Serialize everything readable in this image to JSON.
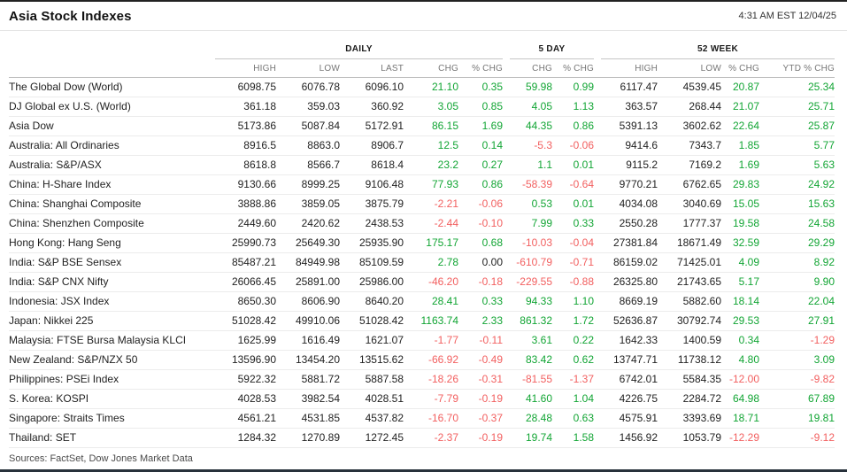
{
  "header": {
    "title": "Asia Stock Indexes",
    "timestamp": "4:31 AM EST 12/04/25"
  },
  "colors": {
    "positive": "#12a534",
    "negative": "#f25f5f",
    "neutral": "#222222"
  },
  "table": {
    "groups": [
      {
        "label": "DAILY"
      },
      {
        "label": "5 DAY"
      },
      {
        "label": "52 WEEK"
      }
    ],
    "column_headers": [
      "HIGH",
      "LOW",
      "LAST",
      "CHG",
      "% CHG",
      "CHG",
      "% CHG",
      "HIGH",
      "LOW",
      "% CHG",
      "YTD % CHG"
    ],
    "rows": [
      {
        "name": "The Global Dow (World)",
        "daily_high": "6098.75",
        "daily_low": "6076.78",
        "daily_last": "6096.10",
        "daily_chg": "21.10",
        "daily_pchg": "0.35",
        "five_day_chg": "59.98",
        "five_day_pchg": "0.99",
        "wk52_high": "6117.47",
        "wk52_low": "4539.45",
        "wk52_pchg": "20.87",
        "ytd_pchg": "25.34"
      },
      {
        "name": "DJ Global ex U.S. (World)",
        "daily_high": "361.18",
        "daily_low": "359.03",
        "daily_last": "360.92",
        "daily_chg": "3.05",
        "daily_pchg": "0.85",
        "five_day_chg": "4.05",
        "five_day_pchg": "1.13",
        "wk52_high": "363.57",
        "wk52_low": "268.44",
        "wk52_pchg": "21.07",
        "ytd_pchg": "25.71"
      },
      {
        "name": "Asia Dow",
        "daily_high": "5173.86",
        "daily_low": "5087.84",
        "daily_last": "5172.91",
        "daily_chg": "86.15",
        "daily_pchg": "1.69",
        "five_day_chg": "44.35",
        "five_day_pchg": "0.86",
        "wk52_high": "5391.13",
        "wk52_low": "3602.62",
        "wk52_pchg": "22.64",
        "ytd_pchg": "25.87"
      },
      {
        "name": "Australia: All Ordinaries",
        "daily_high": "8916.5",
        "daily_low": "8863.0",
        "daily_last": "8906.7",
        "daily_chg": "12.5",
        "daily_pchg": "0.14",
        "five_day_chg": "-5.3",
        "five_day_pchg": "-0.06",
        "wk52_high": "9414.6",
        "wk52_low": "7343.7",
        "wk52_pchg": "1.85",
        "ytd_pchg": "5.77"
      },
      {
        "name": "Australia: S&P/ASX",
        "daily_high": "8618.8",
        "daily_low": "8566.7",
        "daily_last": "8618.4",
        "daily_chg": "23.2",
        "daily_pchg": "0.27",
        "five_day_chg": "1.1",
        "five_day_pchg": "0.01",
        "wk52_high": "9115.2",
        "wk52_low": "7169.2",
        "wk52_pchg": "1.69",
        "ytd_pchg": "5.63"
      },
      {
        "name": "China: H-Share Index",
        "daily_high": "9130.66",
        "daily_low": "8999.25",
        "daily_last": "9106.48",
        "daily_chg": "77.93",
        "daily_pchg": "0.86",
        "five_day_chg": "-58.39",
        "five_day_pchg": "-0.64",
        "wk52_high": "9770.21",
        "wk52_low": "6762.65",
        "wk52_pchg": "29.83",
        "ytd_pchg": "24.92"
      },
      {
        "name": "China: Shanghai Composite",
        "daily_high": "3888.86",
        "daily_low": "3859.05",
        "daily_last": "3875.79",
        "daily_chg": "-2.21",
        "daily_pchg": "-0.06",
        "five_day_chg": "0.53",
        "five_day_pchg": "0.01",
        "wk52_high": "4034.08",
        "wk52_low": "3040.69",
        "wk52_pchg": "15.05",
        "ytd_pchg": "15.63"
      },
      {
        "name": "China: Shenzhen Composite",
        "daily_high": "2449.60",
        "daily_low": "2420.62",
        "daily_last": "2438.53",
        "daily_chg": "-2.44",
        "daily_pchg": "-0.10",
        "five_day_chg": "7.99",
        "five_day_pchg": "0.33",
        "wk52_high": "2550.28",
        "wk52_low": "1777.37",
        "wk52_pchg": "19.58",
        "ytd_pchg": "24.58"
      },
      {
        "name": "Hong Kong: Hang Seng",
        "daily_high": "25990.73",
        "daily_low": "25649.30",
        "daily_last": "25935.90",
        "daily_chg": "175.17",
        "daily_pchg": "0.68",
        "five_day_chg": "-10.03",
        "five_day_pchg": "-0.04",
        "wk52_high": "27381.84",
        "wk52_low": "18671.49",
        "wk52_pchg": "32.59",
        "ytd_pchg": "29.29"
      },
      {
        "name": "India: S&P BSE Sensex",
        "daily_high": "85487.21",
        "daily_low": "84949.98",
        "daily_last": "85109.59",
        "daily_chg": "2.78",
        "daily_pchg": "0.00",
        "five_day_chg": "-610.79",
        "five_day_pchg": "-0.71",
        "wk52_high": "86159.02",
        "wk52_low": "71425.01",
        "wk52_pchg": "4.09",
        "ytd_pchg": "8.92"
      },
      {
        "name": "India: S&P CNX Nifty",
        "daily_high": "26066.45",
        "daily_low": "25891.00",
        "daily_last": "25986.00",
        "daily_chg": "-46.20",
        "daily_pchg": "-0.18",
        "five_day_chg": "-229.55",
        "five_day_pchg": "-0.88",
        "wk52_high": "26325.80",
        "wk52_low": "21743.65",
        "wk52_pchg": "5.17",
        "ytd_pchg": "9.90"
      },
      {
        "name": "Indonesia: JSX Index",
        "daily_high": "8650.30",
        "daily_low": "8606.90",
        "daily_last": "8640.20",
        "daily_chg": "28.41",
        "daily_pchg": "0.33",
        "five_day_chg": "94.33",
        "five_day_pchg": "1.10",
        "wk52_high": "8669.19",
        "wk52_low": "5882.60",
        "wk52_pchg": "18.14",
        "ytd_pchg": "22.04"
      },
      {
        "name": "Japan: Nikkei 225",
        "daily_high": "51028.42",
        "daily_low": "49910.06",
        "daily_last": "51028.42",
        "daily_chg": "1163.74",
        "daily_pchg": "2.33",
        "five_day_chg": "861.32",
        "five_day_pchg": "1.72",
        "wk52_high": "52636.87",
        "wk52_low": "30792.74",
        "wk52_pchg": "29.53",
        "ytd_pchg": "27.91"
      },
      {
        "name": "Malaysia: FTSE Bursa Malaysia KLCI",
        "daily_high": "1625.99",
        "daily_low": "1616.49",
        "daily_last": "1621.07",
        "daily_chg": "-1.77",
        "daily_pchg": "-0.11",
        "five_day_chg": "3.61",
        "five_day_pchg": "0.22",
        "wk52_high": "1642.33",
        "wk52_low": "1400.59",
        "wk52_pchg": "0.34",
        "ytd_pchg": "-1.29"
      },
      {
        "name": "New Zealand: S&P/NZX 50",
        "daily_high": "13596.90",
        "daily_low": "13454.20",
        "daily_last": "13515.62",
        "daily_chg": "-66.92",
        "daily_pchg": "-0.49",
        "five_day_chg": "83.42",
        "five_day_pchg": "0.62",
        "wk52_high": "13747.71",
        "wk52_low": "11738.12",
        "wk52_pchg": "4.80",
        "ytd_pchg": "3.09"
      },
      {
        "name": "Philippines: PSEi Index",
        "daily_high": "5922.32",
        "daily_low": "5881.72",
        "daily_last": "5887.58",
        "daily_chg": "-18.26",
        "daily_pchg": "-0.31",
        "five_day_chg": "-81.55",
        "five_day_pchg": "-1.37",
        "wk52_high": "6742.01",
        "wk52_low": "5584.35",
        "wk52_pchg": "-12.00",
        "ytd_pchg": "-9.82"
      },
      {
        "name": "S. Korea: KOSPI",
        "daily_high": "4028.53",
        "daily_low": "3982.54",
        "daily_last": "4028.51",
        "daily_chg": "-7.79",
        "daily_pchg": "-0.19",
        "five_day_chg": "41.60",
        "five_day_pchg": "1.04",
        "wk52_high": "4226.75",
        "wk52_low": "2284.72",
        "wk52_pchg": "64.98",
        "ytd_pchg": "67.89"
      },
      {
        "name": "Singapore: Straits Times",
        "daily_high": "4561.21",
        "daily_low": "4531.85",
        "daily_last": "4537.82",
        "daily_chg": "-16.70",
        "daily_pchg": "-0.37",
        "five_day_chg": "28.48",
        "five_day_pchg": "0.63",
        "wk52_high": "4575.91",
        "wk52_low": "3393.69",
        "wk52_pchg": "18.71",
        "ytd_pchg": "19.81"
      },
      {
        "name": "Thailand: SET",
        "daily_high": "1284.32",
        "daily_low": "1270.89",
        "daily_last": "1272.45",
        "daily_chg": "-2.37",
        "daily_pchg": "-0.19",
        "five_day_chg": "19.74",
        "five_day_pchg": "1.58",
        "wk52_high": "1456.92",
        "wk52_low": "1053.79",
        "wk52_pchg": "-12.29",
        "ytd_pchg": "-9.12"
      }
    ]
  },
  "footer": {
    "sources": "Sources: FactSet, Dow Jones Market Data"
  }
}
